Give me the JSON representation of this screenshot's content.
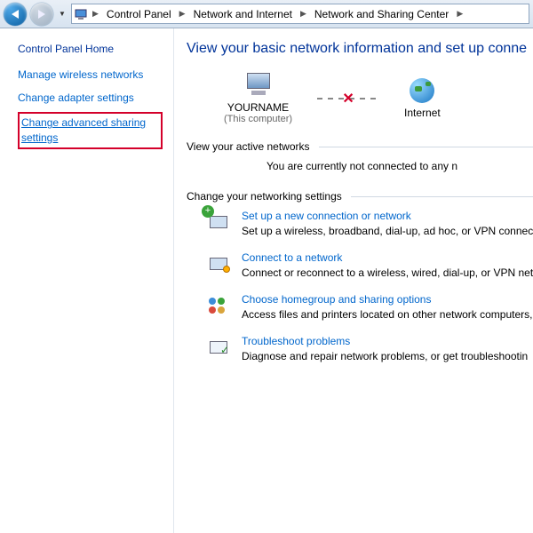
{
  "nav": {
    "crumbs": [
      "Control Panel",
      "Network and Internet",
      "Network and Sharing Center"
    ]
  },
  "sidebar": {
    "home": "Control Panel Home",
    "links": [
      "Manage wireless networks",
      "Change adapter settings",
      "Change advanced sharing settings"
    ]
  },
  "main": {
    "title": "View your basic network information and set up conne",
    "node_computer": "YOURNAME",
    "node_computer_sub": "(This computer)",
    "node_internet": "Internet",
    "active_head": "View your active networks",
    "active_status": "You are currently not connected to any n",
    "change_head": "Change your networking settings",
    "tasks": [
      {
        "title": "Set up a new connection or network",
        "desc": "Set up a wireless, broadband, dial-up, ad hoc, or VPN connect"
      },
      {
        "title": "Connect to a network",
        "desc": "Connect or reconnect to a wireless, wired, dial-up, or VPN net"
      },
      {
        "title": "Choose homegroup and sharing options",
        "desc": "Access files and printers located on other network computers,"
      },
      {
        "title": "Troubleshoot problems",
        "desc": "Diagnose and repair network problems, or get troubleshootin"
      }
    ]
  }
}
